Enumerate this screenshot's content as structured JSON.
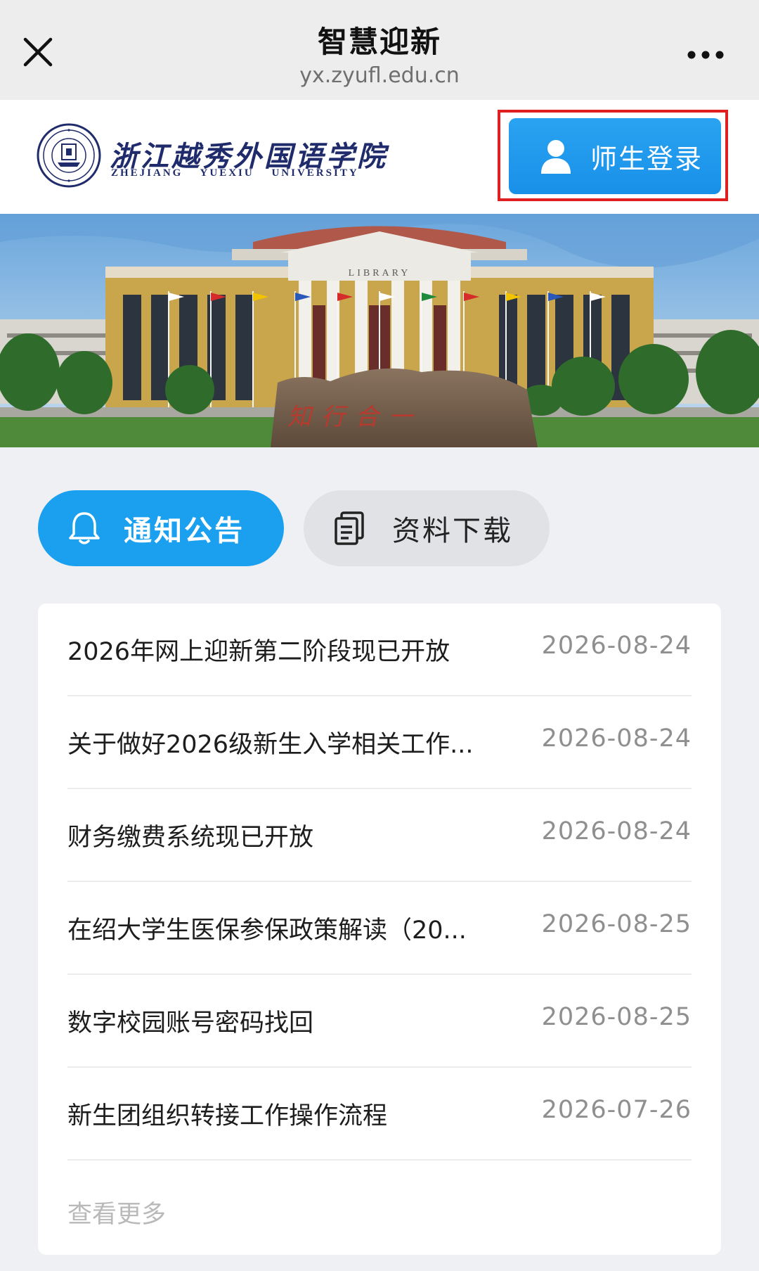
{
  "topbar": {
    "title": "智慧迎新",
    "url": "yx.zyufl.edu.cn"
  },
  "header": {
    "logo_cn": "浙江越秀外国语学院",
    "logo_en": "ZHEJIANG YUEXIU UNIVERSITY",
    "login_label": "师生登录"
  },
  "banner": {
    "building_sign": "LIBRARY",
    "stone_text": "知行合一"
  },
  "tabs": {
    "notice_label": "通知公告",
    "download_label": "资料下载"
  },
  "notices": [
    {
      "title": "2026年网上迎新第二阶段现已开放",
      "date": "2026-08-24"
    },
    {
      "title": "关于做好2026级新生入学相关工作...",
      "date": "2026-08-24"
    },
    {
      "title": "财务缴费系统现已开放",
      "date": "2026-08-24"
    },
    {
      "title": "在绍大学生医保参保政策解读（20...",
      "date": "2026-08-25"
    },
    {
      "title": "数字校园账号密码找回",
      "date": "2026-08-25"
    },
    {
      "title": "新生团组织转接工作操作流程",
      "date": "2026-07-26"
    }
  ],
  "more_label": "查看更多",
  "colors": {
    "accent": "#1aa0ef",
    "login_button": "#1890e8",
    "highlight_border": "#e02020",
    "logo_navy": "#1f2b6b"
  },
  "icons": [
    "close-icon",
    "more-dots-icon",
    "user-icon",
    "bell-icon",
    "document-copy-icon"
  ]
}
